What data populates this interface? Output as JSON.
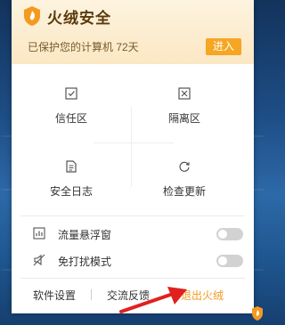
{
  "header": {
    "brand": "火绒安全",
    "protect_text": "已保护您的计算机 72天",
    "enter_button": "进入"
  },
  "grid": {
    "trust": "信任区",
    "quarantine": "隔离区",
    "log": "安全日志",
    "update": "检查更新"
  },
  "toggles": {
    "float_window": "流量悬浮窗",
    "no_disturb": "免打扰模式"
  },
  "footer": {
    "settings": "软件设置",
    "feedback": "交流反馈",
    "exit": "退出火绒"
  },
  "colors": {
    "accent": "#f6a623",
    "exit": "#f39a1f",
    "arrow": "#e02020"
  }
}
